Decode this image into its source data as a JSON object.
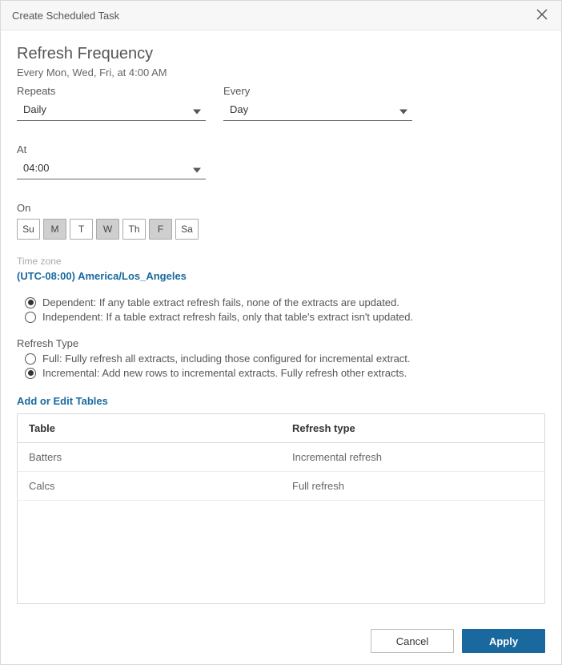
{
  "dialog": {
    "title": "Create Scheduled Task"
  },
  "heading": "Refresh Frequency",
  "summary": "Every Mon, Wed, Fri, at 4:00 AM",
  "repeats": {
    "label": "Repeats",
    "value": "Daily"
  },
  "every": {
    "label": "Every",
    "value": "Day"
  },
  "at": {
    "label": "At",
    "value": "04:00"
  },
  "on": {
    "label": "On",
    "days": [
      {
        "abbr": "Su",
        "selected": false
      },
      {
        "abbr": "M",
        "selected": true
      },
      {
        "abbr": "T",
        "selected": false
      },
      {
        "abbr": "W",
        "selected": true
      },
      {
        "abbr": "Th",
        "selected": false
      },
      {
        "abbr": "F",
        "selected": true
      },
      {
        "abbr": "Sa",
        "selected": false
      }
    ]
  },
  "timezone": {
    "label": "Time zone",
    "value": "(UTC-08:00) America/Los_Angeles"
  },
  "dependency": {
    "dependent": "Dependent: If any table extract refresh fails, none of the extracts are updated.",
    "independent": "Independent: If a table extract refresh fails, only that table's extract isn't updated."
  },
  "refreshType": {
    "heading": "Refresh Type",
    "full": "Full: Fully refresh all extracts, including those configured for incremental extract.",
    "incremental": "Incremental: Add new rows to incremental extracts. Fully refresh other extracts."
  },
  "tables": {
    "link": "Add or Edit Tables",
    "headers": {
      "col1": "Table",
      "col2": "Refresh type"
    },
    "rows": [
      {
        "table": "Batters",
        "type": "Incremental refresh"
      },
      {
        "table": "Calcs",
        "type": "Full refresh"
      }
    ]
  },
  "buttons": {
    "cancel": "Cancel",
    "apply": "Apply"
  }
}
